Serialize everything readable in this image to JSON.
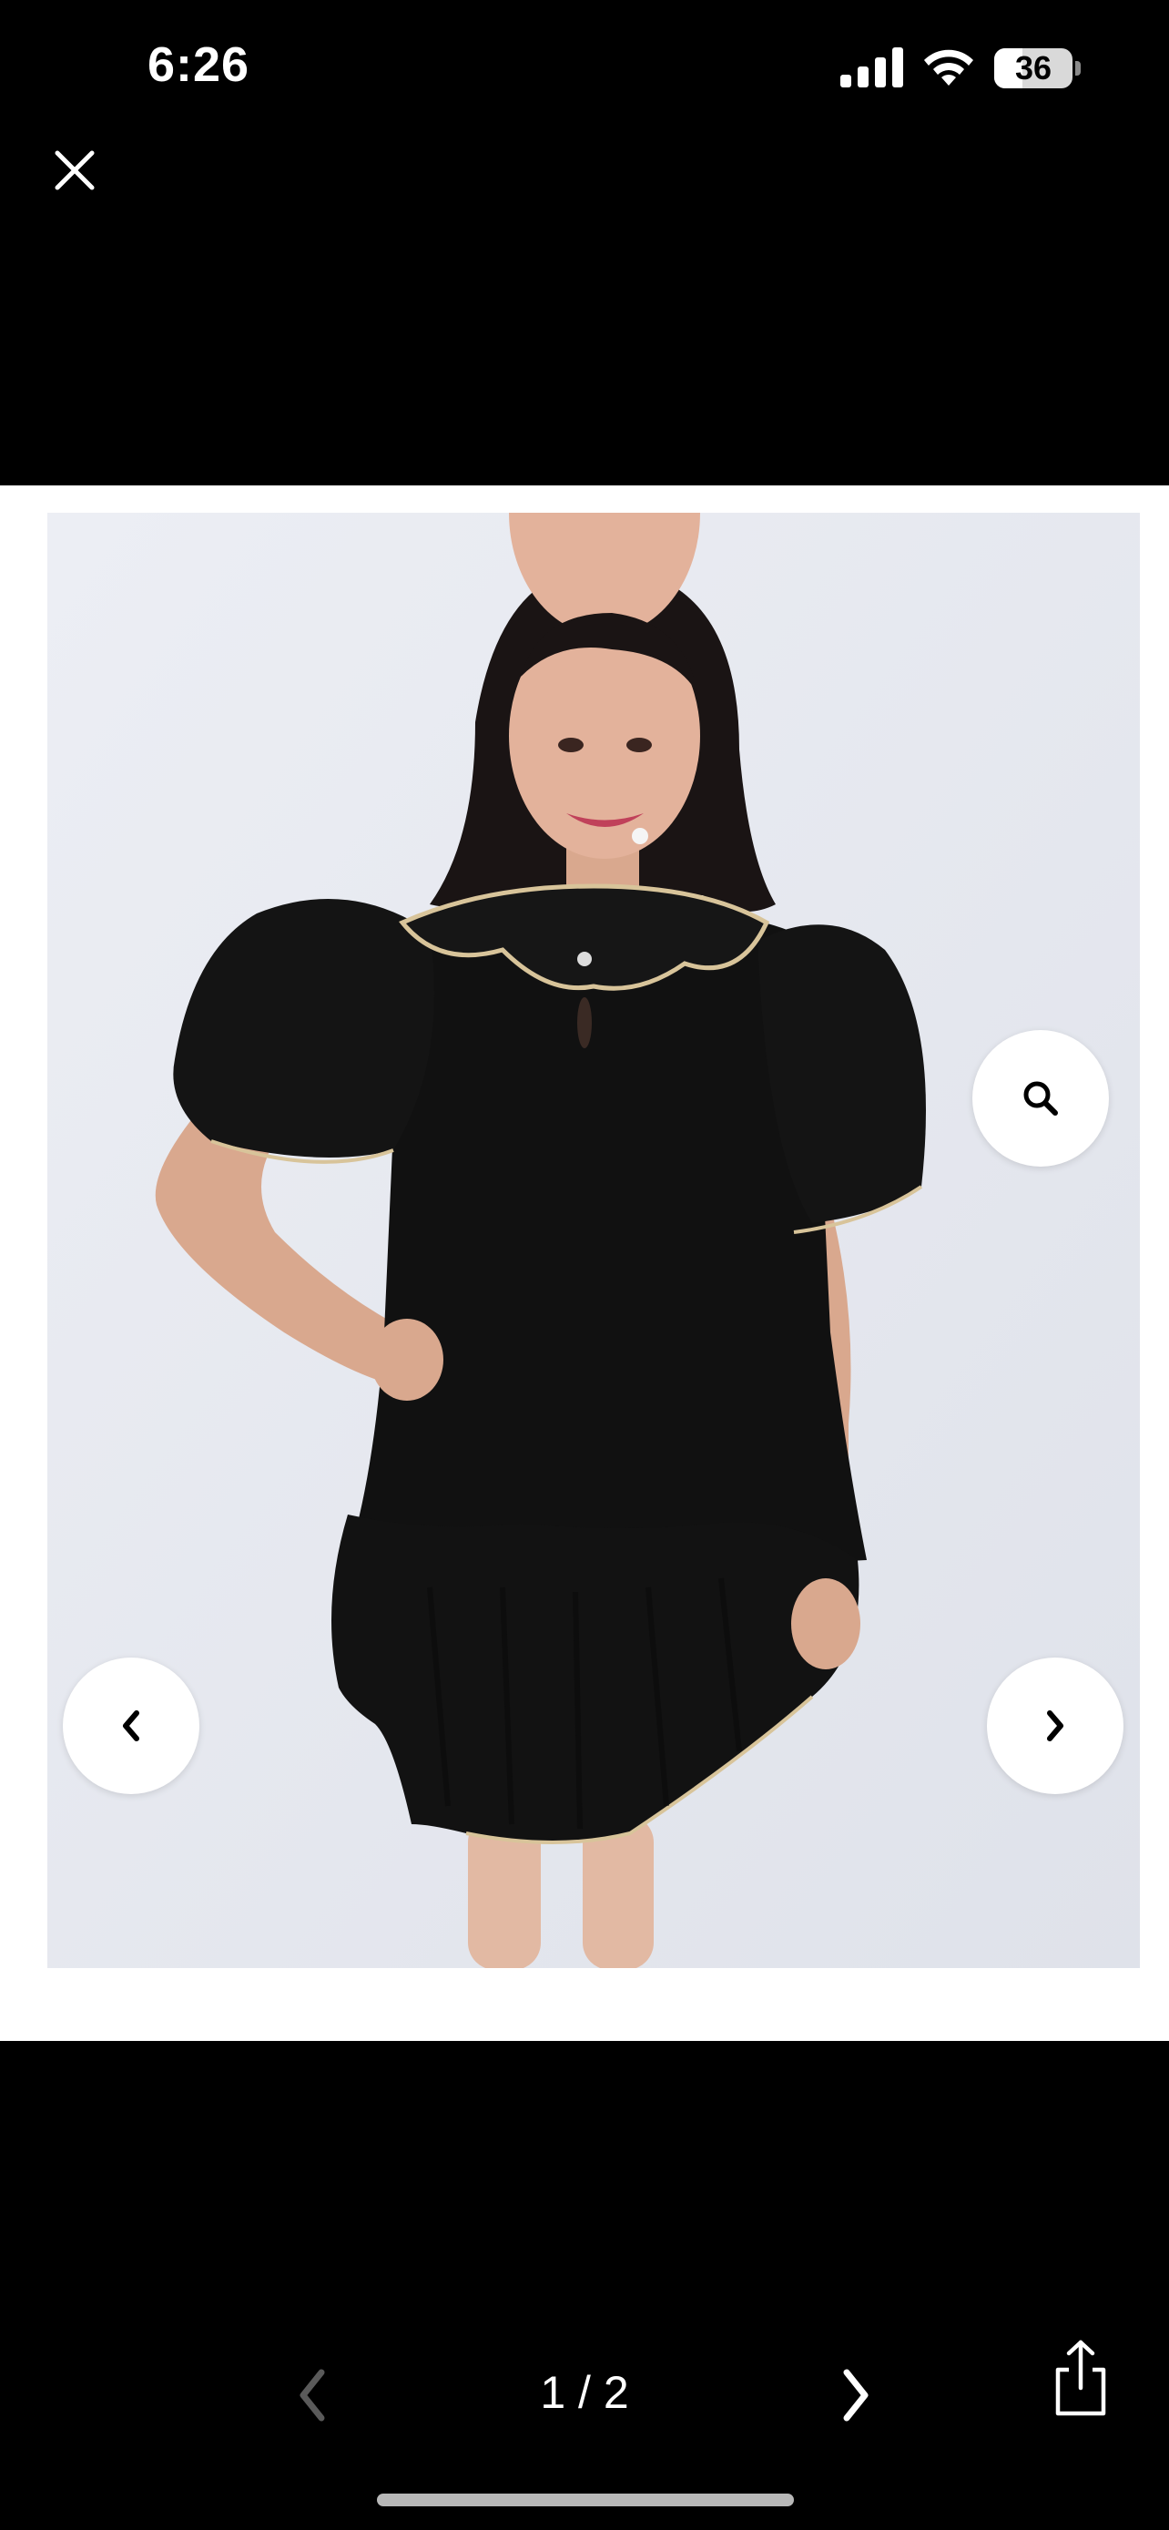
{
  "status_bar": {
    "time": "6:26",
    "battery_level": "36",
    "battery_fraction": 0.36,
    "icons": [
      "cellular-signal-icon",
      "wifi-icon",
      "battery-icon"
    ]
  },
  "toolbar": {
    "close_icon": "close-icon",
    "page_indicator": "1 / 2",
    "prev_icon": "chevron-left-icon",
    "next_icon": "chevron-right-icon",
    "share_icon": "share-icon"
  },
  "viewer": {
    "zoom_icon": "magnifier-icon",
    "prev_icon": "chevron-left-icon",
    "next_icon": "chevron-right-icon"
  },
  "colors": {
    "background": "#000000",
    "card": "#ffffff",
    "photo_backdrop": "#e6e8ef",
    "dress": "#111111",
    "piping": "#d8c49a",
    "disabled_arrow": "#5a5a5a"
  }
}
